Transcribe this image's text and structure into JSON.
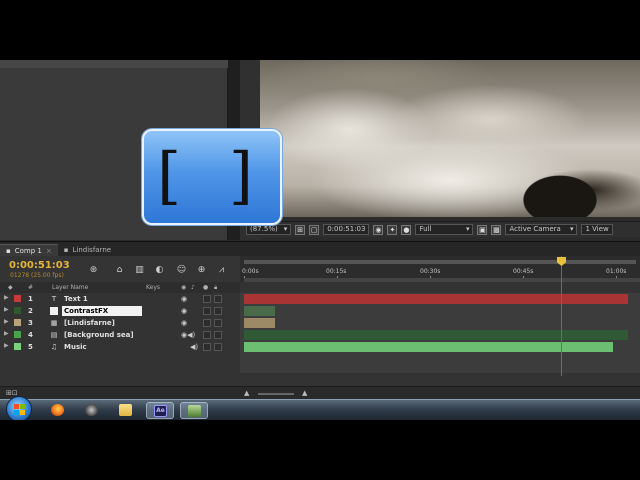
{
  "overlay": {
    "brackets": "[ ]"
  },
  "viewer_toolbar": {
    "magnification": "(87.5%)",
    "timecode": "0:00:51:03",
    "resolution": "Full",
    "camera": "Active Camera",
    "views": "1 View"
  },
  "tabs": [
    {
      "label": "Comp 1",
      "active": true
    },
    {
      "label": "Lindisfarne",
      "active": false
    }
  ],
  "timeline": {
    "current_time": "0:00:51:03",
    "frame_info": "01278 (25.00 fps)",
    "columns": {
      "layer_name": "Layer Name",
      "keys": "Keys"
    },
    "ruler_labels": [
      "0:00s",
      "00:15s",
      "00:30s",
      "00:45s",
      "01:00s"
    ],
    "layers": [
      {
        "num": "1",
        "name": "Text 1",
        "type_icon": "T",
        "label_color": "#c83a3a",
        "audio": false,
        "bar_color": "#a83434",
        "bar_start_s": 0,
        "bar_end_s": 62,
        "selected": false
      },
      {
        "num": "2",
        "name": "ContrastFX",
        "type_icon": "",
        "label_color": "#2f5a2f",
        "audio": false,
        "bar_color": "#4a6b4a",
        "bar_start_s": 0,
        "bar_end_s": 5,
        "selected": true
      },
      {
        "num": "3",
        "name": "[Lindisfarne]",
        "type_icon": "▦",
        "label_color": "#b9a27a",
        "audio": false,
        "bar_color": "#9c8a66",
        "bar_start_s": 0,
        "bar_end_s": 5,
        "selected": false
      },
      {
        "num": "4",
        "name": "[Background sea]",
        "type_icon": "▤",
        "label_color": "#4aa24a",
        "audio": true,
        "bar_color": "#2f5a35",
        "bar_start_s": 0,
        "bar_end_s": 62,
        "selected": false
      },
      {
        "num": "5",
        "name": "Music",
        "type_icon": "♫",
        "label_color": "#7ad27a",
        "audio": true,
        "bar_color": "#6cbf72",
        "bar_start_s": 0,
        "bar_end_s": 59.5,
        "selected": false
      }
    ],
    "current_time_s": 51.1
  },
  "taskbar": {
    "apps": [
      "start",
      "firefox",
      "burn",
      "explorer",
      "after-effects",
      "process-explorer"
    ],
    "ae_label": "Ae",
    "active_app": "after-effects"
  }
}
